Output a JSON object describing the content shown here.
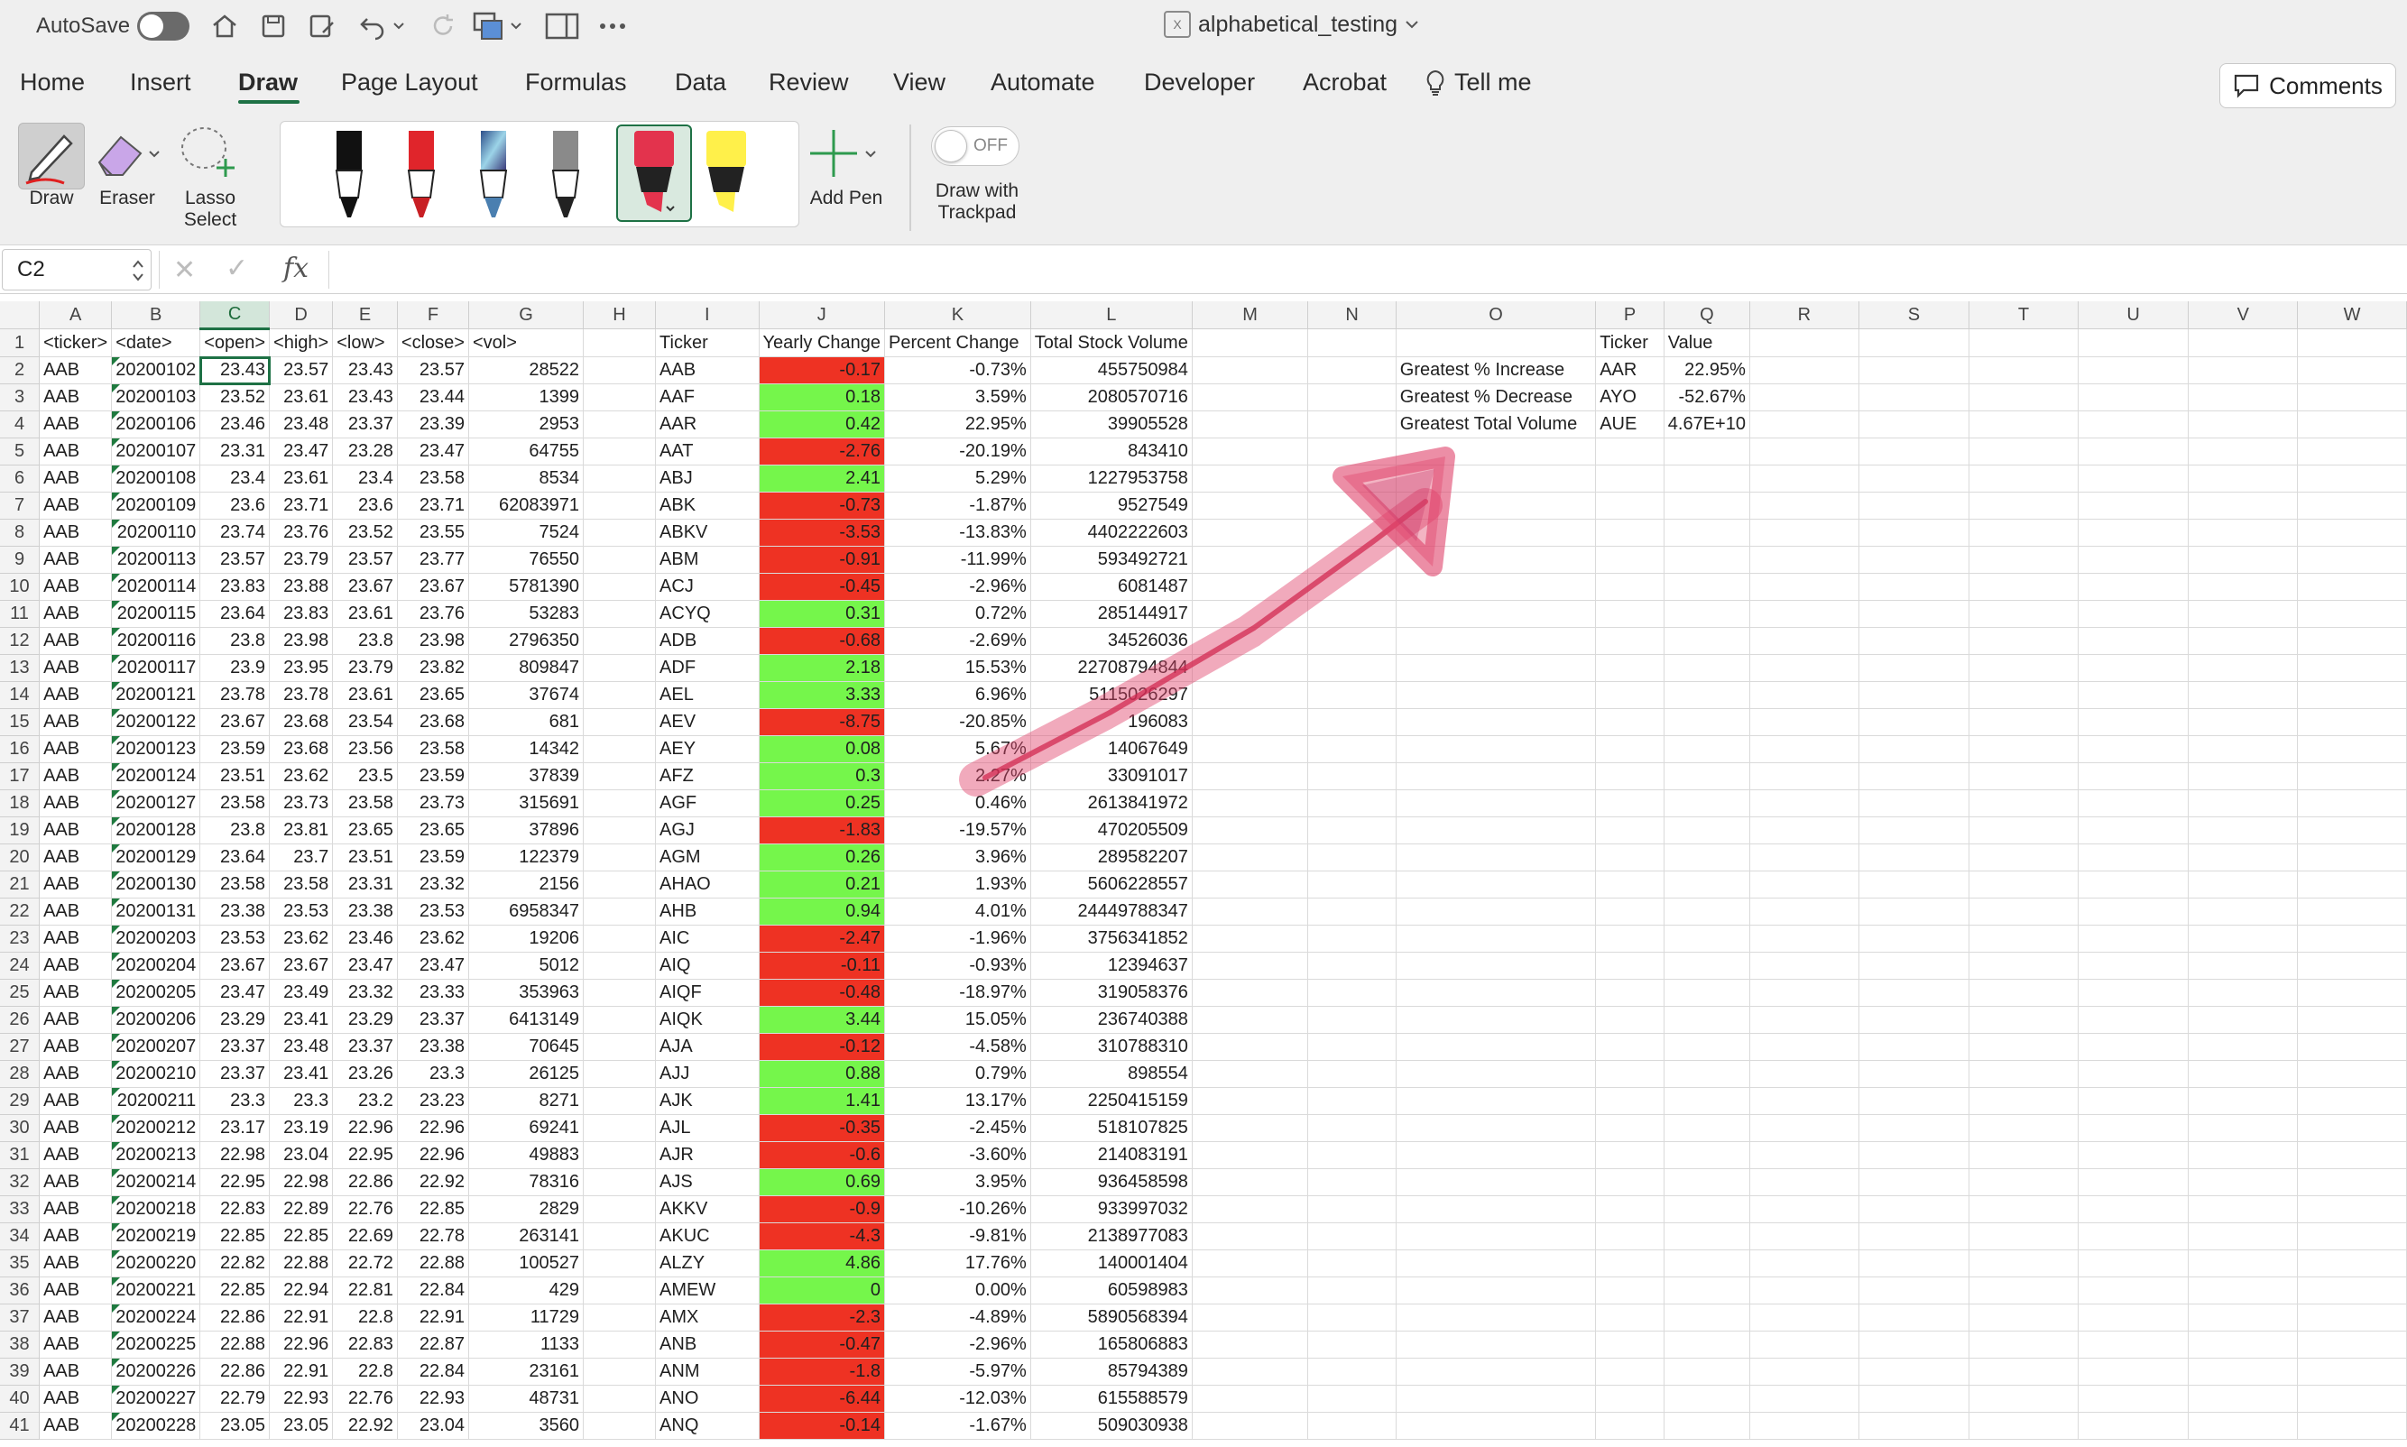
{
  "titlebar": {
    "autosave_label": "AutoSave",
    "doc_title": "alphabetical_testing"
  },
  "menu": {
    "tabs": [
      "Home",
      "Insert",
      "Draw",
      "Page Layout",
      "Formulas",
      "Data",
      "Review",
      "View",
      "Automate",
      "Developer",
      "Acrobat",
      "Tell me"
    ],
    "active": "Draw",
    "comments_label": "Comments"
  },
  "ribbon": {
    "draw_label": "Draw",
    "eraser_label": "Eraser",
    "lasso_label_1": "Lasso",
    "lasso_label_2": "Select",
    "add_pen_label": "Add Pen",
    "trackpad_label_1": "Draw with",
    "trackpad_label_2": "Trackpad",
    "trackpad_state": "OFF",
    "pen_colors": [
      "#111111",
      "#e0252b",
      "#4a7fb0",
      "#8a8a8a",
      "#e3334d",
      "#fff04a"
    ]
  },
  "formula_bar": {
    "name_box": "C2",
    "fx": "fx",
    "cancel": "✕",
    "enter": "✓"
  },
  "sheet": {
    "columns": [
      "A",
      "B",
      "C",
      "D",
      "E",
      "F",
      "G",
      "H",
      "I",
      "J",
      "K",
      "L",
      "M",
      "N",
      "O",
      "P",
      "Q",
      "R",
      "S",
      "T",
      "U",
      "V",
      "W"
    ],
    "selected_column": "C",
    "active_cell": "C2",
    "header_row": [
      "<ticker>",
      "<date>",
      "<open>",
      "<high>",
      "<low>",
      "<close>",
      "<vol>",
      "",
      "Ticker",
      "Yearly Change",
      "Percent Change",
      "Total Stock Volume",
      "",
      "",
      "",
      "Ticker",
      "Value"
    ],
    "rows": [
      [
        "AAB",
        "20200102",
        "23.43",
        "23.57",
        "23.43",
        "23.57",
        "28522",
        "AAB",
        "-0.17",
        "-0.73%",
        "455750984"
      ],
      [
        "AAB",
        "20200103",
        "23.52",
        "23.61",
        "23.43",
        "23.44",
        "1399",
        "AAF",
        "0.18",
        "3.59%",
        "2080570716"
      ],
      [
        "AAB",
        "20200106",
        "23.46",
        "23.48",
        "23.37",
        "23.39",
        "2953",
        "AAR",
        "0.42",
        "22.95%",
        "39905528"
      ],
      [
        "AAB",
        "20200107",
        "23.31",
        "23.47",
        "23.28",
        "23.47",
        "64755",
        "AAT",
        "-2.76",
        "-20.19%",
        "843410"
      ],
      [
        "AAB",
        "20200108",
        "23.4",
        "23.61",
        "23.4",
        "23.58",
        "8534",
        "ABJ",
        "2.41",
        "5.29%",
        "1227953758"
      ],
      [
        "AAB",
        "20200109",
        "23.6",
        "23.71",
        "23.6",
        "23.71",
        "62083971",
        "ABK",
        "-0.73",
        "-1.87%",
        "9527549"
      ],
      [
        "AAB",
        "20200110",
        "23.74",
        "23.76",
        "23.52",
        "23.55",
        "7524",
        "ABKV",
        "-3.53",
        "-13.83%",
        "4402222603"
      ],
      [
        "AAB",
        "20200113",
        "23.57",
        "23.79",
        "23.57",
        "23.77",
        "76550",
        "ABM",
        "-0.91",
        "-11.99%",
        "593492721"
      ],
      [
        "AAB",
        "20200114",
        "23.83",
        "23.88",
        "23.67",
        "23.67",
        "5781390",
        "ACJ",
        "-0.45",
        "-2.96%",
        "6081487"
      ],
      [
        "AAB",
        "20200115",
        "23.64",
        "23.83",
        "23.61",
        "23.76",
        "53283",
        "ACYQ",
        "0.31",
        "0.72%",
        "285144917"
      ],
      [
        "AAB",
        "20200116",
        "23.8",
        "23.98",
        "23.8",
        "23.98",
        "2796350",
        "ADB",
        "-0.68",
        "-2.69%",
        "34526036"
      ],
      [
        "AAB",
        "20200117",
        "23.9",
        "23.95",
        "23.79",
        "23.82",
        "809847",
        "ADF",
        "2.18",
        "15.53%",
        "22708794844"
      ],
      [
        "AAB",
        "20200121",
        "23.78",
        "23.78",
        "23.61",
        "23.65",
        "37674",
        "AEL",
        "3.33",
        "6.96%",
        "5115026297"
      ],
      [
        "AAB",
        "20200122",
        "23.67",
        "23.68",
        "23.54",
        "23.68",
        "681",
        "AEV",
        "-8.75",
        "-20.85%",
        "196083"
      ],
      [
        "AAB",
        "20200123",
        "23.59",
        "23.68",
        "23.56",
        "23.58",
        "14342",
        "AEY",
        "0.08",
        "5.67%",
        "14067649"
      ],
      [
        "AAB",
        "20200124",
        "23.51",
        "23.62",
        "23.5",
        "23.59",
        "37839",
        "AFZ",
        "0.3",
        "2.27%",
        "33091017"
      ],
      [
        "AAB",
        "20200127",
        "23.58",
        "23.73",
        "23.58",
        "23.73",
        "315691",
        "AGF",
        "0.25",
        "0.46%",
        "2613841972"
      ],
      [
        "AAB",
        "20200128",
        "23.8",
        "23.81",
        "23.65",
        "23.65",
        "37896",
        "AGJ",
        "-1.83",
        "-19.57%",
        "470205509"
      ],
      [
        "AAB",
        "20200129",
        "23.64",
        "23.7",
        "23.51",
        "23.59",
        "122379",
        "AGM",
        "0.26",
        "3.96%",
        "289582207"
      ],
      [
        "AAB",
        "20200130",
        "23.58",
        "23.58",
        "23.31",
        "23.32",
        "2156",
        "AHAO",
        "0.21",
        "1.93%",
        "5606228557"
      ],
      [
        "AAB",
        "20200131",
        "23.38",
        "23.53",
        "23.38",
        "23.53",
        "6958347",
        "AHB",
        "0.94",
        "4.01%",
        "24449788347"
      ],
      [
        "AAB",
        "20200203",
        "23.53",
        "23.62",
        "23.46",
        "23.62",
        "19206",
        "AIC",
        "-2.47",
        "-1.96%",
        "3756341852"
      ],
      [
        "AAB",
        "20200204",
        "23.67",
        "23.67",
        "23.47",
        "23.47",
        "5012",
        "AIQ",
        "-0.11",
        "-0.93%",
        "12394637"
      ],
      [
        "AAB",
        "20200205",
        "23.47",
        "23.49",
        "23.32",
        "23.33",
        "353963",
        "AIQF",
        "-0.48",
        "-18.97%",
        "319058376"
      ],
      [
        "AAB",
        "20200206",
        "23.29",
        "23.41",
        "23.29",
        "23.37",
        "6413149",
        "AIQK",
        "3.44",
        "15.05%",
        "236740388"
      ],
      [
        "AAB",
        "20200207",
        "23.37",
        "23.48",
        "23.37",
        "23.38",
        "70645",
        "AJA",
        "-0.12",
        "-4.58%",
        "310788310"
      ],
      [
        "AAB",
        "20200210",
        "23.37",
        "23.41",
        "23.26",
        "23.3",
        "26125",
        "AJJ",
        "0.88",
        "0.79%",
        "898554"
      ],
      [
        "AAB",
        "20200211",
        "23.3",
        "23.3",
        "23.2",
        "23.23",
        "8271",
        "AJK",
        "1.41",
        "13.17%",
        "2250415159"
      ],
      [
        "AAB",
        "20200212",
        "23.17",
        "23.19",
        "22.96",
        "22.96",
        "69241",
        "AJL",
        "-0.35",
        "-2.45%",
        "518107825"
      ],
      [
        "AAB",
        "20200213",
        "22.98",
        "23.04",
        "22.95",
        "22.96",
        "49883",
        "AJR",
        "-0.6",
        "-3.60%",
        "214083191"
      ],
      [
        "AAB",
        "20200214",
        "22.95",
        "22.98",
        "22.86",
        "22.92",
        "78316",
        "AJS",
        "0.69",
        "3.95%",
        "936458598"
      ],
      [
        "AAB",
        "20200218",
        "22.83",
        "22.89",
        "22.76",
        "22.85",
        "2829",
        "AKKV",
        "-0.9",
        "-10.26%",
        "933997032"
      ],
      [
        "AAB",
        "20200219",
        "22.85",
        "22.85",
        "22.69",
        "22.78",
        "263141",
        "AKUC",
        "-4.3",
        "-9.81%",
        "2138977083"
      ],
      [
        "AAB",
        "20200220",
        "22.82",
        "22.88",
        "22.72",
        "22.88",
        "100527",
        "ALZY",
        "4.86",
        "17.76%",
        "140001404"
      ],
      [
        "AAB",
        "20200221",
        "22.85",
        "22.94",
        "22.81",
        "22.84",
        "429",
        "AMEW",
        "0",
        "0.00%",
        "60598983"
      ],
      [
        "AAB",
        "20200224",
        "22.86",
        "22.91",
        "22.8",
        "22.91",
        "11729",
        "AMX",
        "-2.3",
        "-4.89%",
        "5890568394"
      ],
      [
        "AAB",
        "20200225",
        "22.88",
        "22.96",
        "22.83",
        "22.87",
        "1133",
        "ANB",
        "-0.47",
        "-2.96%",
        "165806883"
      ],
      [
        "AAB",
        "20200226",
        "22.86",
        "22.91",
        "22.8",
        "22.84",
        "23161",
        "ANM",
        "-1.8",
        "-5.97%",
        "85794389"
      ],
      [
        "AAB",
        "20200227",
        "22.79",
        "22.93",
        "22.76",
        "22.93",
        "48731",
        "ANO",
        "-6.44",
        "-12.03%",
        "615588579"
      ],
      [
        "AAB",
        "20200228",
        "23.05",
        "23.05",
        "22.92",
        "23.04",
        "3560",
        "ANQ",
        "-0.14",
        "-1.67%",
        "509030938"
      ]
    ],
    "summary": [
      {
        "label": "Greatest % Increase",
        "ticker": "AAR",
        "value": "22.95%"
      },
      {
        "label": "Greatest % Decrease",
        "ticker": "AYO",
        "value": "-52.67%"
      },
      {
        "label": "Greatest Total Volume",
        "ticker": "AUE",
        "value": "4.67E+10"
      }
    ]
  },
  "colors": {
    "negative": "#ee3223",
    "positive": "#75f64b",
    "accent": "#1e7145",
    "annotation": "#e0436a"
  },
  "annotation": {
    "type": "hand-drawn-arrow",
    "color": "#e0436a",
    "from": "J16",
    "to": "N6"
  }
}
